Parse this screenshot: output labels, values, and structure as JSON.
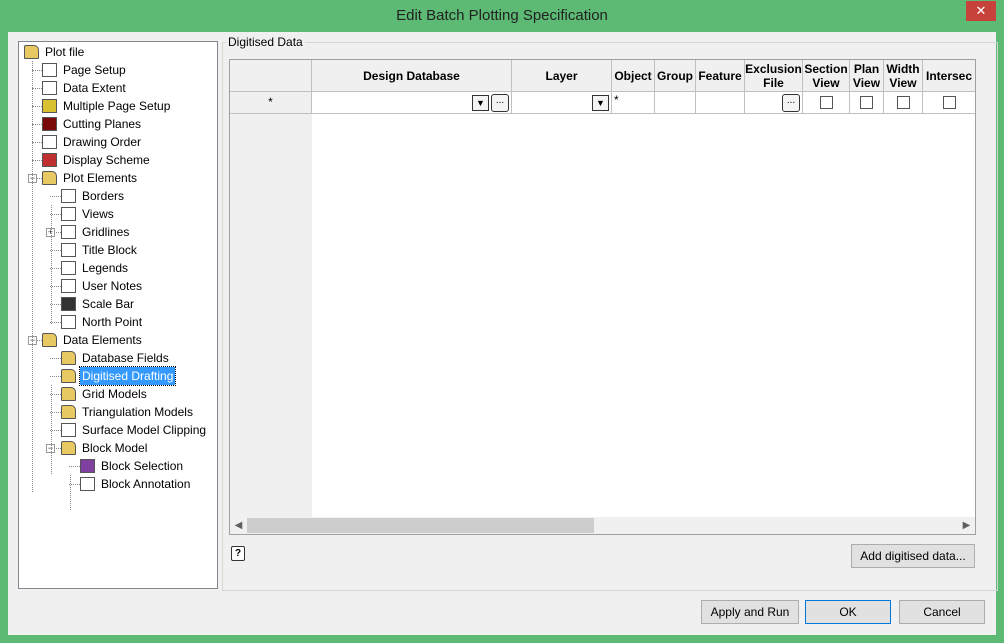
{
  "window": {
    "title": "Edit Batch Plotting Specification",
    "close": "✕"
  },
  "tree": [
    {
      "label": "Plot file",
      "level": 0,
      "icon": "folder-icon",
      "color": "#e8c860"
    },
    {
      "label": "Page Setup",
      "level": 1,
      "icon": "page-setup-icon",
      "color": "#ffffff"
    },
    {
      "label": "Data Extent",
      "level": 1,
      "icon": "data-extent-icon",
      "color": "#ffffff"
    },
    {
      "label": "Multiple Page Setup",
      "level": 1,
      "icon": "multiple-page-icon",
      "color": "#d8c030"
    },
    {
      "label": "Cutting Planes",
      "level": 1,
      "icon": "cube-icon",
      "color": "#7a0a0a"
    },
    {
      "label": "Drawing Order",
      "level": 1,
      "icon": "numbers-icon",
      "color": "#ffffff"
    },
    {
      "label": "Display Scheme",
      "level": 1,
      "icon": "colour-grid-icon",
      "color": "#c03030"
    },
    {
      "label": "Plot Elements",
      "level": 1,
      "icon": "folder-icon",
      "color": "#e8c860",
      "expanded": true
    },
    {
      "label": "Borders",
      "level": 2,
      "icon": "border-icon",
      "color": "#ffffff"
    },
    {
      "label": "Views",
      "level": 2,
      "icon": "views-icon",
      "color": "#ffffff"
    },
    {
      "label": "Gridlines",
      "level": 2,
      "icon": "grid-icon",
      "color": "#ffffff",
      "collapsed": true
    },
    {
      "label": "Title Block",
      "level": 2,
      "icon": "title-block-icon",
      "color": "#ffffff"
    },
    {
      "label": "Legends",
      "level": 2,
      "icon": "legend-icon",
      "color": "#ffffff"
    },
    {
      "label": "User Notes",
      "level": 2,
      "icon": "note-icon",
      "color": "#ffffff"
    },
    {
      "label": "Scale Bar",
      "level": 2,
      "icon": "scale-bar-icon",
      "color": "#333333"
    },
    {
      "label": "North Point",
      "level": 2,
      "icon": "north-point-icon",
      "color": "#ffffff"
    },
    {
      "label": "Data Elements",
      "level": 1,
      "icon": "folder-icon",
      "color": "#e8c860",
      "expanded": true
    },
    {
      "label": "Database Fields",
      "level": 2,
      "icon": "folder-icon",
      "color": "#e8c860"
    },
    {
      "label": "Digitised Drafting",
      "level": 2,
      "icon": "folder-icon",
      "color": "#e8c860",
      "selected": true
    },
    {
      "label": "Grid Models",
      "level": 2,
      "icon": "folder-icon",
      "color": "#e8c860"
    },
    {
      "label": "Triangulation Models",
      "level": 2,
      "icon": "folder-icon",
      "color": "#e8c860"
    },
    {
      "label": "Surface Model Clipping",
      "level": 2,
      "icon": "clipping-icon",
      "color": "#ffffff"
    },
    {
      "label": "Block Model",
      "level": 2,
      "icon": "folder-icon",
      "color": "#e8c860",
      "expanded": true
    },
    {
      "label": "Block Selection",
      "level": 3,
      "icon": "block-selection-icon",
      "color": "#8040a0"
    },
    {
      "label": "Block Annotation",
      "level": 3,
      "icon": "block-annotation-icon",
      "color": "#ffffff"
    }
  ],
  "group": {
    "label": "Digitised Data"
  },
  "grid": {
    "columns": [
      "",
      "Design Database",
      "Layer",
      "Object",
      "Group",
      "Feature",
      "Exclusion File",
      "Section View",
      "Plan View",
      "Width View",
      "Intersec"
    ],
    "row": {
      "header": "*",
      "object": "*",
      "ellipsis": "...",
      "dropdown": "▼"
    }
  },
  "help": "?",
  "buttons": {
    "add": "Add digitised data...",
    "apply": "Apply and Run",
    "ok": "OK",
    "cancel": "Cancel"
  }
}
